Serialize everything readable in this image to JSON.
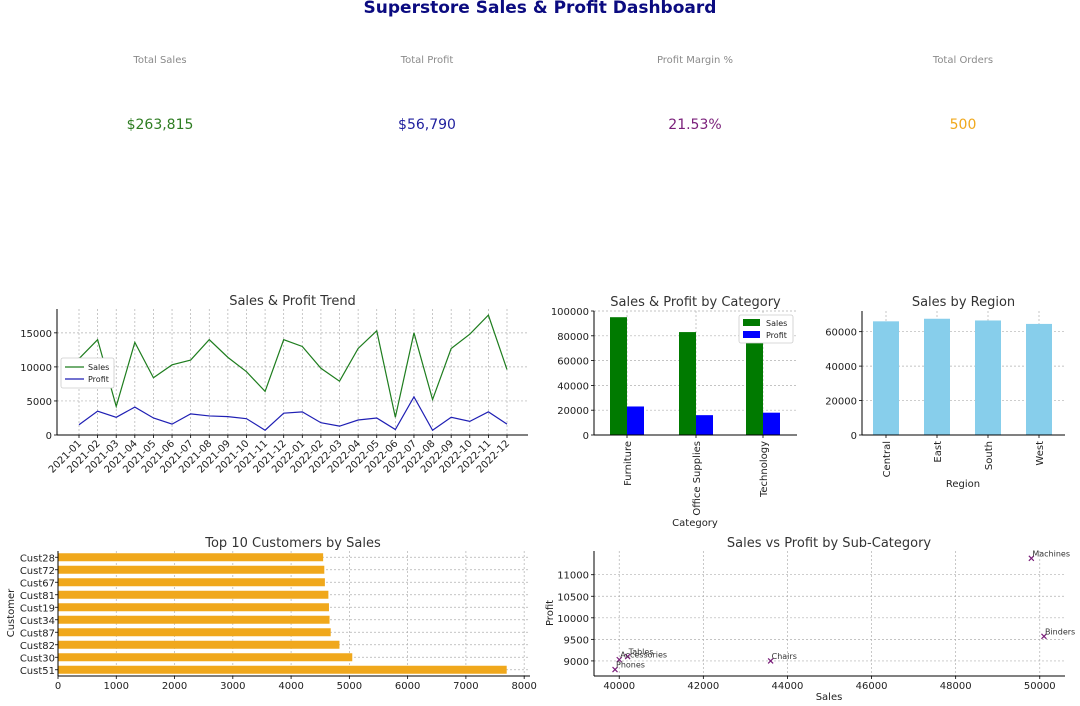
{
  "dashboard": {
    "title": "Superstore Sales & Profit Dashboard"
  },
  "kpis": [
    {
      "label": "Total Sales",
      "value": "$263,815",
      "color": "#2e7d22"
    },
    {
      "label": "Total Profit",
      "value": "$56,790",
      "color": "#1f1f9e"
    },
    {
      "label": "Profit Margin %",
      "value": "21.53%",
      "color": "#7a1f7a"
    },
    {
      "label": "Total Orders",
      "value": "500",
      "color": "#f0a81c"
    }
  ],
  "chart_data": [
    {
      "id": "trend",
      "type": "line",
      "title": "Sales & Profit Trend",
      "x": [
        "2021-01",
        "2021-02",
        "2021-03",
        "2021-04",
        "2021-05",
        "2021-06",
        "2021-07",
        "2021-08",
        "2021-09",
        "2021-10",
        "2021-11",
        "2021-12",
        "2022-01",
        "2022-02",
        "2022-03",
        "2022-04",
        "2022-05",
        "2022-06",
        "2022-07",
        "2022-08",
        "2022-09",
        "2022-10",
        "2022-11",
        "2022-12"
      ],
      "series": [
        {
          "name": "Sales",
          "color": "#1e7d1e",
          "values": [
            11200,
            14000,
            4200,
            13600,
            8400,
            10300,
            11000,
            14000,
            11400,
            9300,
            6400,
            14000,
            13000,
            9800,
            7900,
            12700,
            15300,
            2600,
            15000,
            5200,
            12700,
            14800,
            17600,
            9600
          ]
        },
        {
          "name": "Profit",
          "color": "#1f1fb4",
          "values": [
            1500,
            3500,
            2600,
            4100,
            2500,
            1600,
            3100,
            2800,
            2700,
            2400,
            700,
            3200,
            3400,
            1800,
            1300,
            2200,
            2500,
            800,
            5600,
            700,
            2600,
            2000,
            3400,
            1600
          ]
        }
      ],
      "ylim": [
        0,
        18500
      ],
      "yticks": [
        0,
        5000,
        10000,
        15000
      ],
      "grid": true,
      "legend": "center-left"
    },
    {
      "id": "category",
      "type": "bar",
      "title": "Sales & Profit by Category",
      "xlabel": "Category",
      "categories": [
        "Furniture",
        "Office Supplies",
        "Technology"
      ],
      "series": [
        {
          "name": "Sales",
          "color": "#007a00",
          "values": [
            95000,
            83000,
            84000
          ]
        },
        {
          "name": "Profit",
          "color": "#0000ff",
          "values": [
            23000,
            16000,
            18000
          ]
        }
      ],
      "ylim": [
        0,
        100000
      ],
      "yticks": [
        0,
        20000,
        40000,
        60000,
        80000,
        100000
      ],
      "grid": true,
      "legend": "top-right"
    },
    {
      "id": "region",
      "type": "bar",
      "title": "Sales by Region",
      "xlabel": "Region",
      "categories": [
        "Central",
        "East",
        "South",
        "West"
      ],
      "values": [
        66000,
        67500,
        66500,
        64500
      ],
      "color": "#87ceeb",
      "ylim": [
        0,
        72000
      ],
      "yticks": [
        0,
        20000,
        40000,
        60000
      ],
      "grid": true
    },
    {
      "id": "customers",
      "type": "bar",
      "orientation": "horizontal",
      "title": "Top 10 Customers by Sales",
      "ylabel": "Customer",
      "categories": [
        "Cust51",
        "Cust30",
        "Cust82",
        "Cust87",
        "Cust34",
        "Cust19",
        "Cust81",
        "Cust67",
        "Cust72",
        "Cust28"
      ],
      "values": [
        7700,
        5050,
        4830,
        4680,
        4660,
        4650,
        4640,
        4580,
        4570,
        4550
      ],
      "color": "#f0a81c",
      "xlim": [
        0,
        8100
      ],
      "xticks": [
        0,
        1000,
        2000,
        3000,
        4000,
        5000,
        6000,
        7000,
        8000
      ],
      "grid": true
    },
    {
      "id": "subcat",
      "type": "scatter",
      "title": "Sales vs Profit by Sub-Category",
      "xlabel": "Sales",
      "ylabel": "Profit",
      "points": [
        {
          "label": "Machines",
          "x": 49800,
          "y": 11380
        },
        {
          "label": "Binders",
          "x": 50100,
          "y": 9570
        },
        {
          "label": "Chairs",
          "x": 43600,
          "y": 9000
        },
        {
          "label": "Tables",
          "x": 40200,
          "y": 9100
        },
        {
          "label": "Accessories",
          "x": 40000,
          "y": 9030
        },
        {
          "label": "Phones",
          "x": 39900,
          "y": 8800
        }
      ],
      "color": "#7a1f7a",
      "xlim": [
        39400,
        50600
      ],
      "ylim": [
        8650,
        11550
      ],
      "xticks": [
        40000,
        42000,
        44000,
        46000,
        48000,
        50000
      ],
      "yticks": [
        9000,
        9500,
        10000,
        10500,
        11000
      ],
      "grid": true
    }
  ]
}
